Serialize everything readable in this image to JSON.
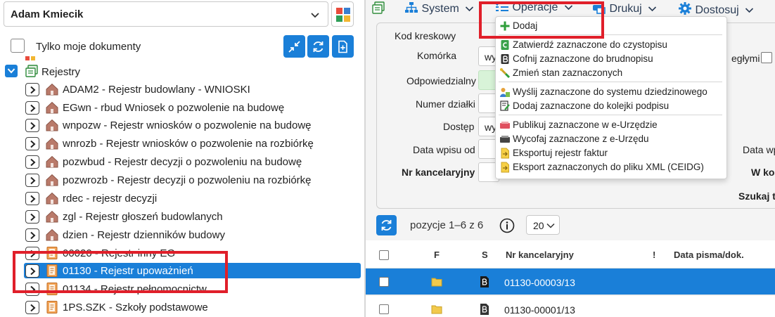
{
  "left_panel": {
    "user_select": {
      "value": "Adam Kmiecik"
    },
    "only_mine_label": "Tylko moje dokumenty",
    "tree": {
      "root_label": "Rejestry",
      "items": [
        {
          "label": "ADAM2 - Rejestr budowlany - WNIOSKI",
          "icon": "house-icon"
        },
        {
          "label": "EGwn - rbud Wniosek o pozwolenie na budowę",
          "icon": "house-icon"
        },
        {
          "label": "wnpozw - Rejestr wniosków o pozwolenie na budowę",
          "icon": "house-icon"
        },
        {
          "label": "wnrozb - Rejestr wniosków o pozwolenie na rozbiórkę",
          "icon": "house-icon"
        },
        {
          "label": "pozwbud - Rejestr decyzji o pozwoleniu na budowę",
          "icon": "house-icon"
        },
        {
          "label": "pozwrozb - Rejestr decyzji o pozwoleniu na rozbiórkę",
          "icon": "house-icon"
        },
        {
          "label": "rdec - rejestr decyzji",
          "icon": "house-icon"
        },
        {
          "label": "zgl - Rejestr głoszeń budowlanych",
          "icon": "house-icon"
        },
        {
          "label": "dzien - Rejestr dzienników budowy",
          "icon": "house-icon"
        },
        {
          "label": "00020 - Rejestr inny EG",
          "icon": "register-book-icon"
        },
        {
          "label": "01130 - Rejestr upoważnień",
          "icon": "register-book-icon",
          "selected": true
        },
        {
          "label": "01134 - Rejestr pełnomocnictw",
          "icon": "register-book-icon"
        },
        {
          "label": "1PS.SZK - Szkoły podstawowe",
          "icon": "register-book-icon"
        }
      ]
    }
  },
  "menubar": {
    "system": "System",
    "operacje": "Operacje",
    "drukuj": "Drukuj",
    "dostosuj": "Dostosuj"
  },
  "operacje_menu": {
    "items": [
      {
        "label": "Dodaj",
        "icon": "plus-icon"
      },
      {
        "label": "Zatwierdź zaznaczone do czystopisu",
        "icon": "green-document-icon"
      },
      {
        "label": "Cofnij zaznaczone do brudnopisu",
        "icon": "dark-document-icon"
      },
      {
        "label": "Zmień stan zaznaczonych",
        "icon": "state-change-icon"
      },
      {
        "label": "Wyślij zaznaczone do systemu dziedzinowego",
        "icon": "send-to-system-icon"
      },
      {
        "label": "Dodaj zaznaczone do kolejki podpisu",
        "icon": "signature-queue-icon"
      },
      {
        "label": "Publikuj zaznaczone w e-Urzędzie",
        "icon": "publish-icon"
      },
      {
        "label": "Wycofaj zaznaczone z e-Urzędu",
        "icon": "withdraw-icon"
      },
      {
        "label": "Eksportuj rejestr faktur",
        "icon": "export-icon"
      },
      {
        "label": "Eksport zaznaczonych do pliku XML (CEIDG)",
        "icon": "export-xml-icon"
      }
    ]
  },
  "filters": {
    "kod_kreskowy": "Kod kreskowy",
    "komorka": "Komórka",
    "komorka_value": "wy",
    "odpowiedzialny": "Odpowiedzialny",
    "numer_dzialki": "Numer działki",
    "dostep": "Dostęp",
    "dostep_value": "wy",
    "data_wpisu_od": "Data wpisu od",
    "nr_kancelaryjny": "Nr kancelaryjny",
    "right_partial_1": "egłymi",
    "right_partial_2": "Data wp",
    "right_partial_3": "W kol",
    "right_partial_4": "Szukaj t"
  },
  "pager": {
    "text": "pozycje 1–6 z 6",
    "page_size": "20"
  },
  "grid": {
    "columns": {
      "f": "F",
      "s": "S",
      "nr": "Nr kancelaryjny",
      "excl": "!",
      "data": "Data pisma/dok."
    },
    "rows": [
      {
        "nr": "01130-00003/13",
        "selected": true
      },
      {
        "nr": "01130-00001/13",
        "selected": false
      }
    ]
  },
  "colors": {
    "accent": "#1a7fd8",
    "highlight_red": "#e01f2a",
    "menu_text": "#2b3d56"
  }
}
